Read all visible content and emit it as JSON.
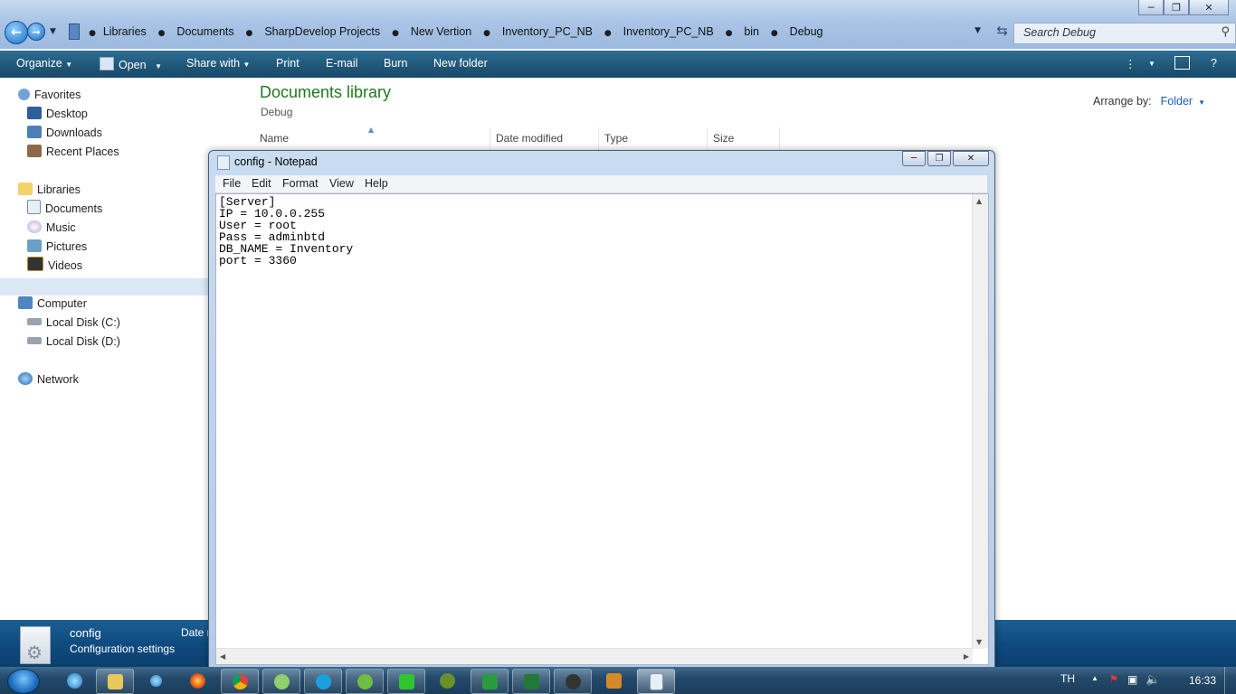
{
  "explorer": {
    "breadcrumb": [
      "Libraries",
      "Documents",
      "SharpDevelop Projects",
      "New Vertion",
      "Inventory_PC_NB",
      "Inventory_PC_NB",
      "bin",
      "Debug"
    ],
    "search_placeholder": "Search Debug",
    "toolbar": {
      "organize": "Organize",
      "open": "Open",
      "share_with": "Share with",
      "print": "Print",
      "email": "E-mail",
      "burn": "Burn",
      "new_folder": "New folder"
    },
    "nav": {
      "favorites": "Favorites",
      "desktop": "Desktop",
      "downloads": "Downloads",
      "recent_places": "Recent Places",
      "libraries": "Libraries",
      "documents": "Documents",
      "music": "Music",
      "pictures": "Pictures",
      "videos": "Videos",
      "computer": "Computer",
      "local_c": "Local Disk (C:)",
      "local_d": "Local Disk (D:)",
      "network": "Network"
    },
    "library_title": "Documents library",
    "library_subtitle": "Debug",
    "arrange_by_label": "Arrange by:",
    "arrange_by_value": "Folder",
    "columns": [
      "Name",
      "Date modified",
      "Type",
      "Size"
    ],
    "details": {
      "file_name": "config",
      "file_type": "Configuration settings",
      "date_label": "Date m"
    }
  },
  "notepad": {
    "title": "config - Notepad",
    "menu": [
      "File",
      "Edit",
      "Format",
      "View",
      "Help"
    ],
    "content": "[Server]\nIP = 10.0.0.255\nUser = root\nPass = adminbtd\nDB_NAME = Inventory\nport = 3360"
  },
  "taskbar": {
    "language": "TH",
    "clock": "16:33"
  }
}
